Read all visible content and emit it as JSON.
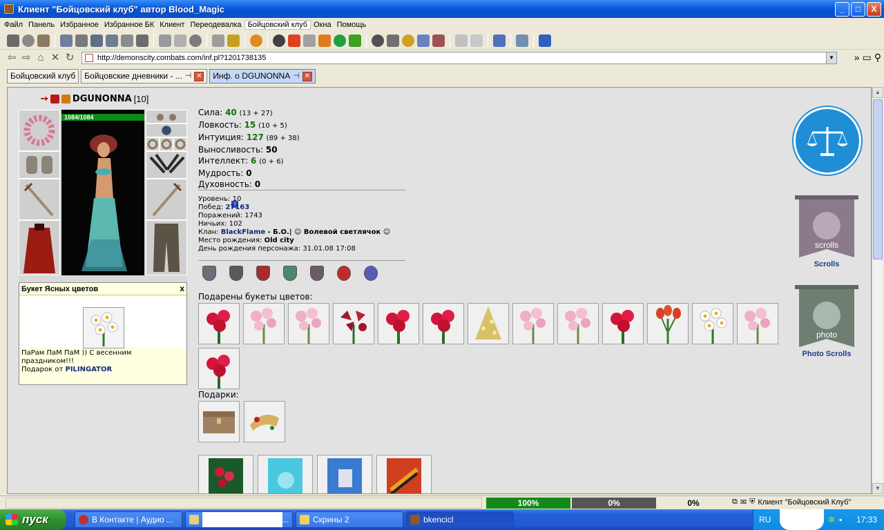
{
  "window": {
    "title": "Клиент \"Бойцовский клуб\" автор Blood_Magic",
    "buttons": [
      "_",
      "□",
      "X"
    ]
  },
  "menu": [
    "Файл",
    "Панель",
    "Избранное",
    "Избранное БК",
    "Клиент",
    "Переодевалка",
    "Бойцовский клуб",
    "Окна",
    "Помощь"
  ],
  "address": {
    "url": "http://demonscity.combats.com/inf.pl?1201738135"
  },
  "tabs": [
    {
      "label": "Бойцовский клуб",
      "closable": false
    },
    {
      "label": "Бойцовские дневники - ...",
      "closable": true
    },
    {
      "label": "Инф. о DGUNONNA",
      "closable": true,
      "active": true
    }
  ],
  "character": {
    "name": "DGUNONNA",
    "level_tag": "[10]",
    "info_icon": "i",
    "hp": "1084/1084"
  },
  "stats": [
    {
      "label": "Сила:",
      "value": "40",
      "detail": "(13 + 27)"
    },
    {
      "label": "Ловкость:",
      "value": "15",
      "detail": "(10 + 5)"
    },
    {
      "label": "Интуиция:",
      "value": "127",
      "detail": "(89 + 38)"
    },
    {
      "label": "Выносливость:",
      "value": "50",
      "detail": ""
    },
    {
      "label": "Интеллект:",
      "value": "6",
      "detail": "(0 + 6)"
    },
    {
      "label": "Мудрость:",
      "value": "0",
      "detail": ""
    },
    {
      "label": "Духовность:",
      "value": "0",
      "detail": ""
    }
  ],
  "info": {
    "level_label": "Уровень:",
    "level": "10",
    "wins_label": "Побед:",
    "wins": "27163",
    "losses_label": "Поражений:",
    "losses": "1743",
    "draws_label": "Ничьих:",
    "draws": "102",
    "clan_label": "Клан:",
    "clan": "BlackFlame",
    "clan_rest": "- Б.О.| ☺ Волевой светлячок ☺",
    "birthplace_label": "Место рождения:",
    "birthplace": "Old city",
    "birthday_label": "День рождения персонажа:",
    "birthday": "31.01.08 17:08"
  },
  "sections": {
    "flowers_title": "Подарены букеты цветов:",
    "gifts_title": "Подарки:"
  },
  "gift_tooltip": {
    "title": "Букет Ясных цветов",
    "close": "x",
    "message": "ПаРам ПаМ ПаМ )) С весенним праздником!!!",
    "from_label": "Подарок от",
    "from": "PILINGATOR"
  },
  "emblems": {
    "scrolls_label": "Scrolls",
    "photo_label": "Photo Scrolls",
    "scrolls_banner_text": "scrolls",
    "photo_banner_text": "photo"
  },
  "statusbar": {
    "progress1": "100%",
    "progress2": "0%",
    "progress3": "0%",
    "client_label": "Клиент \"Бойцовский Клуб\""
  },
  "taskbar": {
    "start": "пуск",
    "tasks": [
      "В Контакте | Аудио ...",
      "Окн...",
      "Скрины 2",
      "bkencicl"
    ],
    "lang": "RU",
    "clock": "17:33"
  }
}
